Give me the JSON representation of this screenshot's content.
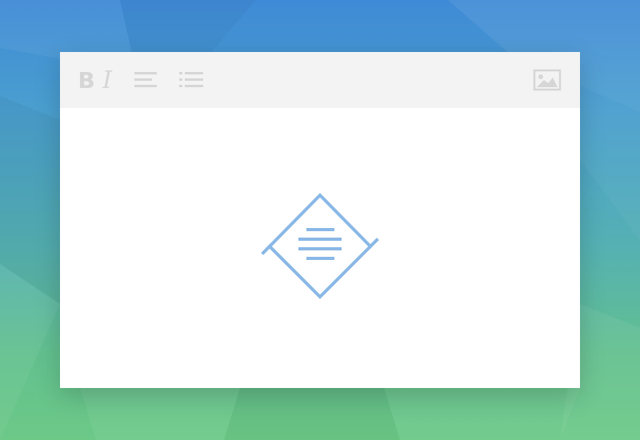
{
  "toolbar": {
    "bold_label": "B",
    "italic_label": "I",
    "icons": [
      "bold-icon",
      "italic-icon",
      "align-left-icon",
      "bulleted-list-icon",
      "image-icon"
    ]
  },
  "content": {
    "placeholder_icon": "text-document-diamond-icon"
  },
  "colors": {
    "background_top": "#3f8ad6",
    "background_bottom": "#6cc987",
    "toolbar_bg": "#f3f3f3",
    "toolbar_icon": "#d6d6d6",
    "editor_bg": "#ffffff",
    "accent": "#8ab8e6"
  }
}
